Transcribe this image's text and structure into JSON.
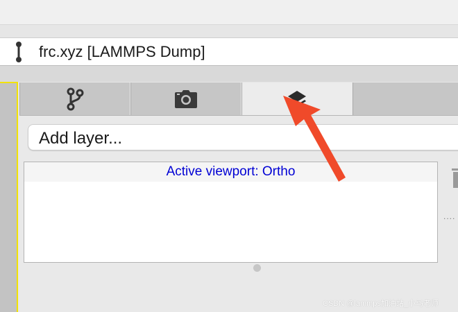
{
  "pipeline": {
    "item_label": "frc.xyz [LAMMPS Dump]"
  },
  "tabs": [
    {
      "name": "pipeline",
      "icon": "pipeline-branch-icon",
      "active": false
    },
    {
      "name": "render",
      "icon": "camera-icon",
      "active": false
    },
    {
      "name": "viewport-layers",
      "icon": "layers-icon",
      "active": true
    },
    {
      "name": "extra",
      "icon": "",
      "active": false
    }
  ],
  "layers": {
    "add_label": "Add layer...",
    "header": "Active viewport: Ortho"
  },
  "watermark": "CSDN @lammps加油站_小马老师",
  "colors": {
    "active_viewport_border": "#f2e200",
    "header_text": "#0000d4",
    "annotation_arrow": "#f04a2a"
  }
}
